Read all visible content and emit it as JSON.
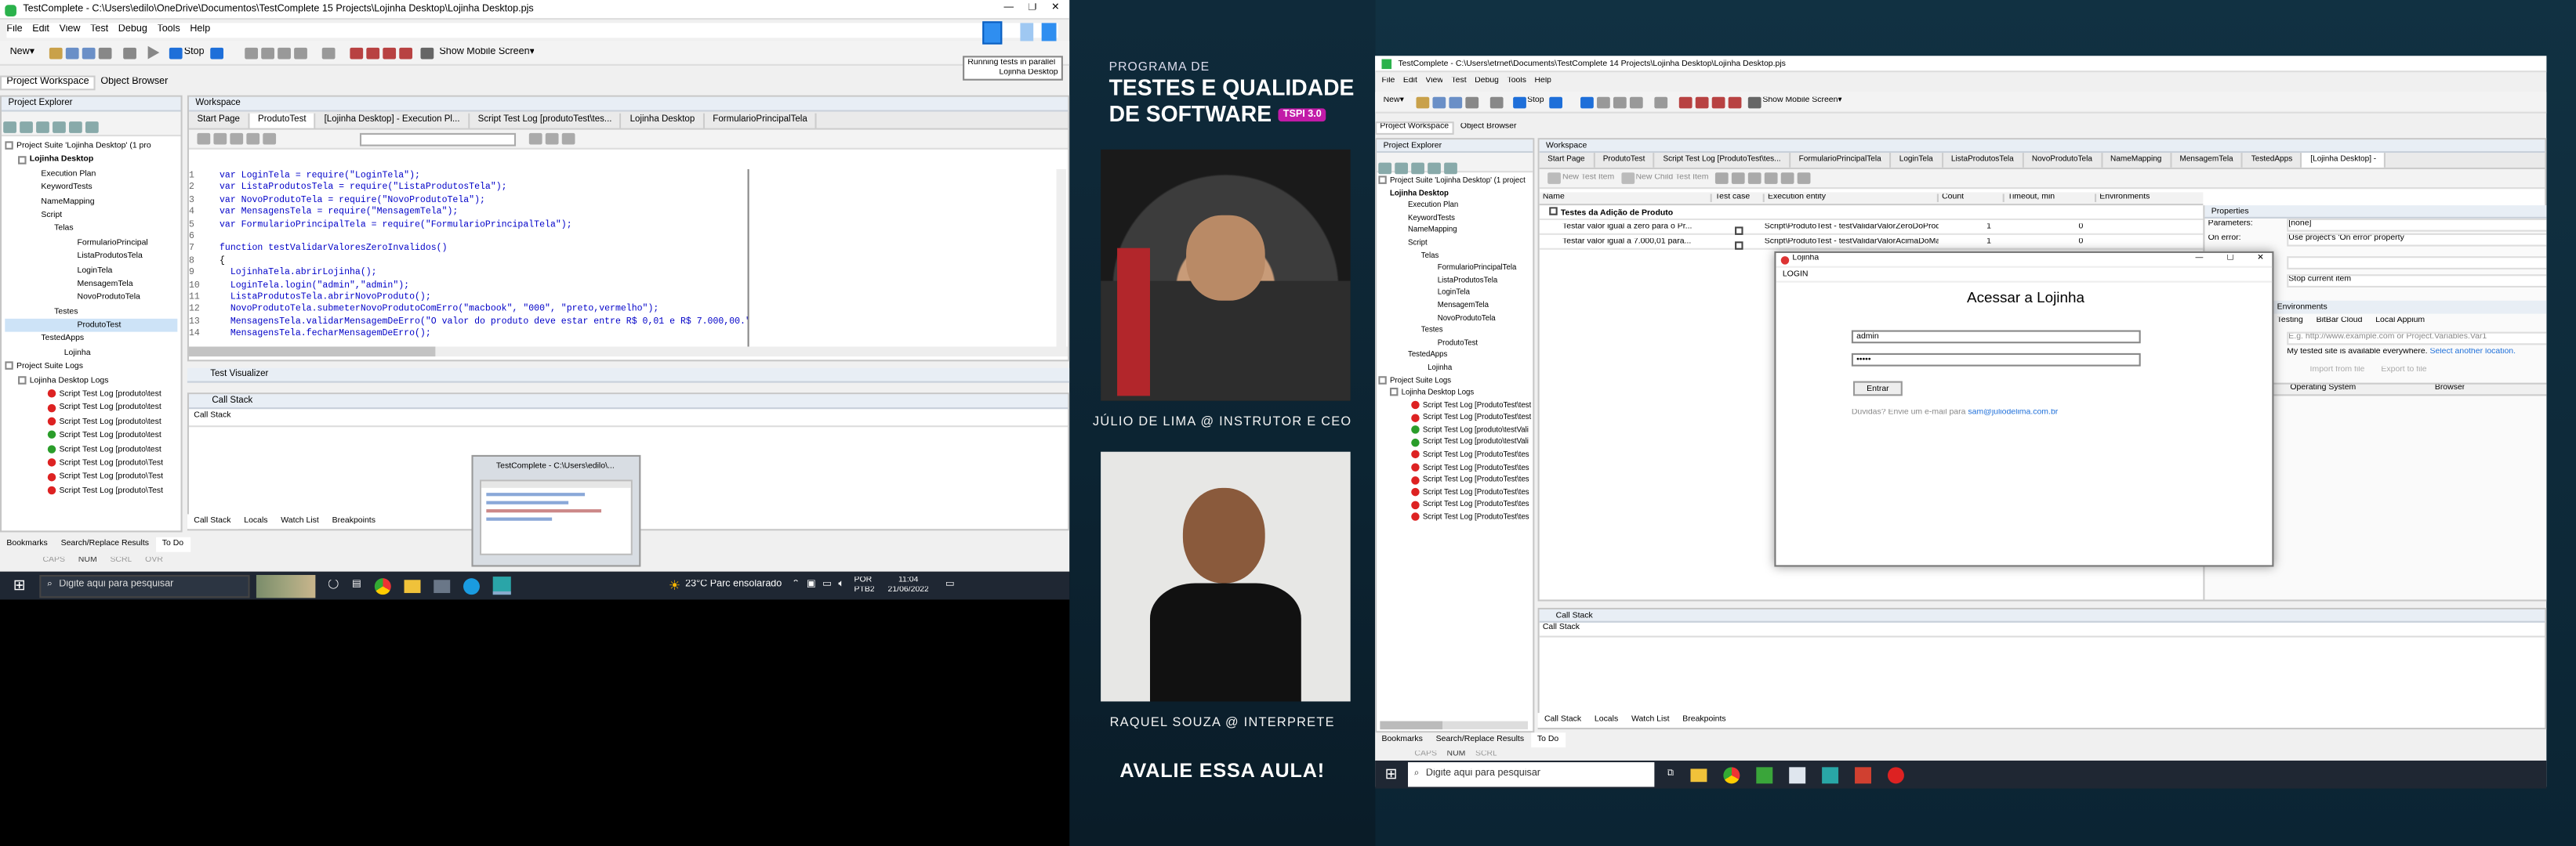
{
  "left": {
    "title": "TestComplete - C:\\Users\\edilo\\OneDrive\\Documentos\\TestComplete 15 Projects\\Lojinha Desktop\\Lojinha Desktop.pjs",
    "menu": [
      "File",
      "Edit",
      "View",
      "Test",
      "Debug",
      "Tools",
      "Help"
    ],
    "toolbar": {
      "new": "New",
      "stop": "Stop",
      "show_mobile": "Show Mobile Screen"
    },
    "tooltip": {
      "line1": "Running tests in parallel",
      "line2": "Lojinha Desktop"
    },
    "panel_tabs": [
      "Project Workspace",
      "Object Browser"
    ],
    "project_explorer": {
      "title": "Project Explorer",
      "items": [
        "Project Suite 'Lojinha Desktop' (1 pro",
        "Lojinha Desktop",
        "Execution Plan",
        "KeywordTests",
        "NameMapping",
        "Script",
        "Telas",
        "FormularioPrincipal",
        "ListaProdutosTela",
        "LoginTela",
        "MensagemTela",
        "NovoProdutoTela",
        "Testes",
        "ProdutoTest",
        "TestedApps",
        "Lojinha",
        "Project Suite Logs",
        "Lojinha Desktop Logs"
      ],
      "logs": [
        "Script Test Log [produto\\test",
        "Script Test Log [produto\\test",
        "Script Test Log [produto\\test",
        "Script Test Log [produto\\test",
        "Script Test Log [produto\\test",
        "Script Test Log [produto\\Test",
        "Script Test Log [produto\\Test",
        "Script Test Log [produto\\Test"
      ]
    },
    "workspace_title": "Workspace",
    "tabs": [
      "Start Page",
      "ProdutoTest",
      "[Lojinha Desktop] - Execution Pl...",
      "Script Test Log [produtoTest\\tes...",
      "Lojinha Desktop",
      "FormularioPrincipalTela"
    ],
    "code": [
      {
        "n": "1",
        "t": "var LoginTela = require(\"LoginTela\");"
      },
      {
        "n": "2",
        "t": "var ListaProdutosTela = require(\"ListaProdutosTela\");"
      },
      {
        "n": "3",
        "t": "var NovoProdutoTela = require(\"NovoProdutoTela\");"
      },
      {
        "n": "4",
        "t": "var MensagensTela = require(\"MensagemTela\");"
      },
      {
        "n": "5",
        "t": "var FormularioPrincipalTela = require(\"FormularioPrincipalTela\");"
      },
      {
        "n": "6",
        "t": ""
      },
      {
        "n": "7",
        "t": "function testValidarValoresZeroInvalidos()"
      },
      {
        "n": "8",
        "t": "{"
      },
      {
        "n": "9",
        "t": "  LojinhaTela.abrirLojinha();"
      },
      {
        "n": "10",
        "t": "  LoginTela.login(\"admin\",\"admin\");"
      },
      {
        "n": "11",
        "t": "  ListaProdutosTela.abrirNovoProduto();"
      },
      {
        "n": "12",
        "t": "  NovoProdutoTela.submeterNovoProdutoComErro(\"macbook\", \"000\", \"preto,vermelho\");"
      },
      {
        "n": "13",
        "t": "  MensagensTela.validarMensagemDeErro(\"O valor do produto deve estar entre R$ 0,01 e R$ 7.000,00.\");"
      },
      {
        "n": "14",
        "t": "  MensagensTela.fecharMensagemDeErro();"
      }
    ],
    "test_visualizer": "Test Visualizer",
    "call_stack_title": "Call Stack",
    "call_stack_header": "Call Stack",
    "bottom_tabs": [
      "Call Stack",
      "Locals",
      "Watch List",
      "Breakpoints"
    ],
    "footer_tabs": [
      "Bookmarks",
      "Search/Replace Results",
      "To Do"
    ],
    "status": [
      "CAPS",
      "NUM",
      "SCRL",
      "OVR"
    ],
    "thumb_title": "TestComplete - C:\\Users\\edilo\\..."
  },
  "taskbar": {
    "search": "Digite aqui para pesquisar",
    "weather": "23°C  Parc ensolarado",
    "lang1": "POR",
    "lang2": "PTB2",
    "time": "11:04",
    "date": "21/06/2022"
  },
  "middle": {
    "program": "PROGRAMA DE",
    "title1": "TESTES E QUALIDADE",
    "title2": "DE SOFTWARE",
    "badge": "TSPI 3.0",
    "instructor": "JÚLIO DE LIMA @ INSTRUTOR E CEO",
    "interpreter": "RAQUEL SOUZA @ INTERPRETE",
    "cta": "AVALIE ESSA AULA!"
  },
  "right": {
    "title": "TestComplete - C:\\Users\\etrnet\\Documents\\TestComplete 14 Projects\\Lojinha Desktop\\Lojinha Desktop.pjs",
    "menu": [
      "File",
      "Edit",
      "View",
      "Test",
      "Debug",
      "Tools",
      "Help"
    ],
    "toolbar": {
      "new": "New",
      "stop": "Stop",
      "show_mobile": "Show Mobile Screen"
    },
    "panel_tabs": [
      "Project Workspace",
      "Object Browser"
    ],
    "explorer_title": "Project Explorer",
    "tree": [
      "Project Suite 'Lojinha Desktop' (1 project",
      "Lojinha Desktop",
      "Execution Plan",
      "KeywordTests",
      "NameMapping",
      "Script",
      "Telas",
      "FormularioPrincipalTela",
      "ListaProdutosTela",
      "LoginTela",
      "MensagemTela",
      "NovoProdutoTela",
      "Testes",
      "ProdutoTest",
      "TestedApps",
      "Lojinha",
      "Project Suite Logs",
      "Lojinha Desktop Logs"
    ],
    "logs": [
      "Script Test Log [ProdutoTest\\test1]",
      "Script Test Log [ProdutoTest\\test1]",
      "Script Test Log [produto\\testVali",
      "Script Test Log [produto\\testVali",
      "Script Test Log [ProdutoTest\\tes",
      "Script Test Log [ProdutoTest\\tes",
      "Script Test Log [ProdutoTest\\tes",
      "Script Test Log [ProdutoTest\\tes",
      "Script Test Log [ProdutoTest\\tes",
      "Script Test Log [ProdutoTest\\tes"
    ],
    "workspace_title": "Workspace",
    "tabs": [
      "Start Page",
      "ProdutoTest",
      "Script Test Log [ProdutoTest\\tes...",
      "FormularioPrincipalTela",
      "LoginTela",
      "ListaProdutosTela",
      "NovoProdutoTela",
      "NameMapping",
      "MensagemTela",
      "TestedApps",
      "[Lojinha Desktop] -"
    ],
    "sub_toolbar": [
      "New Test Item",
      "New Child Test Item"
    ],
    "grid_headers": [
      "Name",
      "Test case",
      "Execution entity",
      "Count",
      "Timeout, min",
      "Environments"
    ],
    "grid_group": "Testes da Adição de Produto",
    "grid_rows": [
      {
        "name": "Testar valor igual a zero para o Pr...",
        "entity": "Script\\ProdutoTest - testValidarValorZeroDoProduto",
        "count": "1",
        "env": "0"
      },
      {
        "name": "Testar valor igual a 7.000,01 para...",
        "entity": "Script\\ProdutoTest - testValidarValorAcimaDoMaximo",
        "count": "1",
        "env": "0"
      }
    ],
    "properties": {
      "title": "Properties",
      "params_label": "Parameters:",
      "params_val": "[none]",
      "onerror_label": "On error:",
      "onerror_val": "Use project's 'On error' property",
      "stop_val": "Stop current item",
      "env_title": "Environments",
      "testing": "Testing",
      "bitbar": "BitBar Cloud",
      "local": "Local Appium",
      "url_hint": "E.g. http://www.example.com or Project.Variables.Var1",
      "site_note": "My tested site is available everywhere.",
      "site_link": "Select another location.",
      "import": "Import from file",
      "export": "Export to file",
      "os": "Operating System",
      "browser": "Browser"
    },
    "dialog": {
      "title": "Lojinha",
      "menu": "LOGIN",
      "heading": "Acessar a Lojinha",
      "user": "admin",
      "password": "•••••",
      "button": "Entrar",
      "help": "Dúvidas? Envie um e-mail para ",
      "email": "sam@juliodelima.com.br"
    },
    "callstack_title": "Call Stack",
    "callstack_header": "Call Stack",
    "bottom_tabs": [
      "Call Stack",
      "Locals",
      "Watch List",
      "Breakpoints"
    ],
    "footer_tabs": [
      "Bookmarks",
      "Search/Replace Results",
      "To Do"
    ],
    "status": [
      "CAPS",
      "NUM",
      "SCRL"
    ]
  },
  "taskbar2": {
    "search": "Digite aqui para pesquisar"
  }
}
